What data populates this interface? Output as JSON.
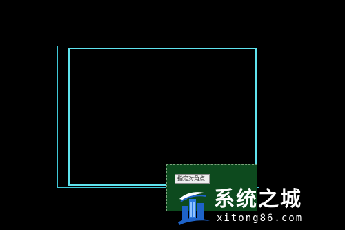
{
  "viewport": {
    "background_color": "#000000"
  },
  "drawing": {
    "outer_rectangle_color": "#3fc7d6",
    "inner_rectangle_color": "#5fe3ee"
  },
  "selection": {
    "fill_color": "#0d4a1e",
    "border_color": "#7ca37d"
  },
  "tooltip": {
    "prompt_text": "指定对角点:"
  },
  "watermark": {
    "site_name": "系统之城",
    "domain": "xitong86.com",
    "logo_icon": "building-logo-icon",
    "logo_color": "#1e63c8"
  }
}
